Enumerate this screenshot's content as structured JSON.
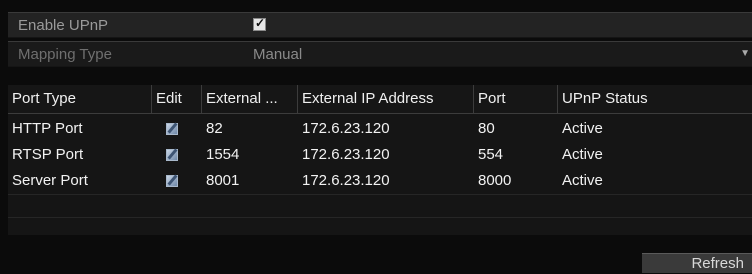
{
  "enable_upnp": {
    "label": "Enable UPnP",
    "checked": true
  },
  "mapping_type": {
    "label": "Mapping Type",
    "value": "Manual"
  },
  "table": {
    "headers": [
      "Port Type",
      "Edit",
      "External ...",
      "External IP Address",
      "Port",
      "UPnP Status"
    ],
    "rows": [
      {
        "port_type": "HTTP Port",
        "external": "82",
        "ip": "172.6.23.120",
        "port": "80",
        "status": "Active"
      },
      {
        "port_type": "RTSP Port",
        "external": "1554",
        "ip": "172.6.23.120",
        "port": "554",
        "status": "Active"
      },
      {
        "port_type": "Server Port",
        "external": "8001",
        "ip": "172.6.23.120",
        "port": "8000",
        "status": "Active"
      }
    ]
  },
  "buttons": {
    "refresh": "Refresh"
  }
}
